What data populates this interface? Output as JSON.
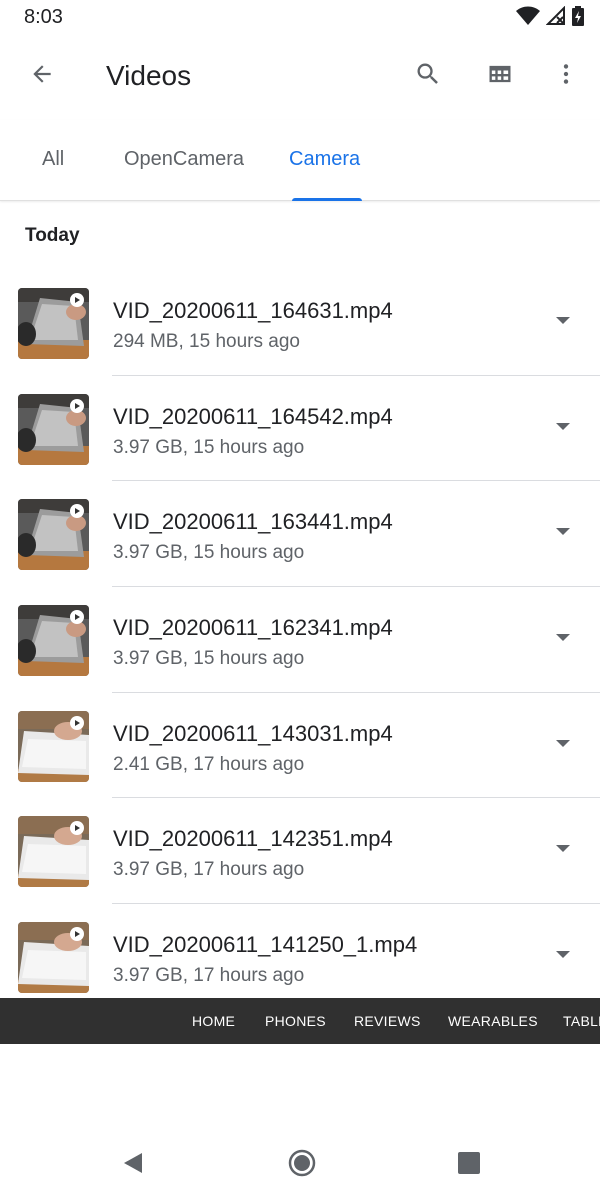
{
  "status_bar": {
    "time": "8:03",
    "icons": [
      "wifi-icon",
      "signal-off-icon",
      "battery-charging-icon"
    ]
  },
  "app_bar": {
    "title": "Videos",
    "back_icon": "arrow-back-icon",
    "actions": [
      "search-icon",
      "grid-view-icon",
      "more-vert-icon"
    ]
  },
  "tabs": [
    {
      "label": "All",
      "active": false
    },
    {
      "label": "OpenCamera",
      "active": false
    },
    {
      "label": "Camera",
      "active": true
    }
  ],
  "section": {
    "header": "Today"
  },
  "files": [
    {
      "name": "VID_20200611_164631.mp4",
      "meta": "294 MB, 15 hours ago",
      "thumb": "dark-keyboard"
    },
    {
      "name": "VID_20200611_164542.mp4",
      "meta": "3.97 GB, 15 hours ago",
      "thumb": "dark-keyboard"
    },
    {
      "name": "VID_20200611_163441.mp4",
      "meta": "3.97 GB, 15 hours ago",
      "thumb": "dark-keyboard"
    },
    {
      "name": "VID_20200611_162341.mp4",
      "meta": "3.97 GB, 15 hours ago",
      "thumb": "dark-keyboard"
    },
    {
      "name": "VID_20200611_143031.mp4",
      "meta": "2.41 GB, 17 hours ago",
      "thumb": "light-keyboard"
    },
    {
      "name": "VID_20200611_142351.mp4",
      "meta": "3.97 GB, 17 hours ago",
      "thumb": "light-keyboard"
    },
    {
      "name": "VID_20200611_141250_1.mp4",
      "meta": "3.97 GB, 17 hours ago",
      "thumb": "light-keyboard"
    }
  ],
  "web_nav": {
    "items": [
      "HOME",
      "PHONES",
      "REVIEWS",
      "WEARABLES",
      "TABLETS"
    ]
  },
  "system_nav": [
    "back-triangle-icon",
    "home-circle-icon",
    "recents-square-icon"
  ],
  "colors": {
    "accent": "#1a73e8",
    "text_primary": "#202124",
    "text_secondary": "#5f6368",
    "web_nav_bg": "#303030"
  }
}
